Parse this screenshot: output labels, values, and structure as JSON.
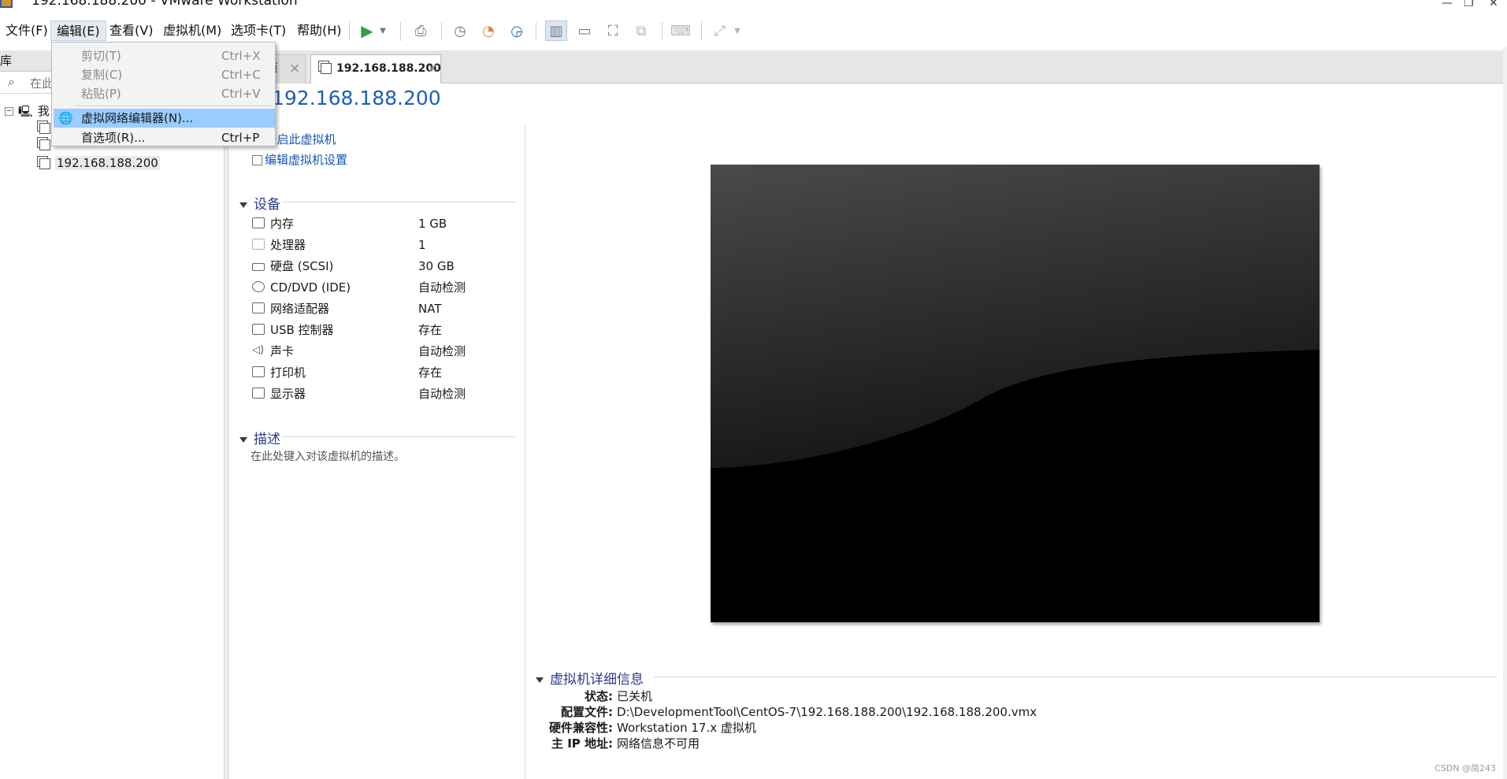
{
  "window": {
    "title": "192.168.188.200 - VMware Workstation"
  },
  "menubar": {
    "items": [
      "文件(F)",
      "编辑(E)",
      "查看(V)",
      "虚拟机(M)",
      "选项卡(T)",
      "帮助(H)"
    ]
  },
  "edit_menu": {
    "items": [
      {
        "label": "剪切(T)",
        "shortcut": "Ctrl+X"
      },
      {
        "label": "复制(C)",
        "shortcut": "Ctrl+C"
      },
      {
        "label": "粘贴(P)",
        "shortcut": "Ctrl+V"
      },
      {
        "label": "虚拟网络编辑器(N)...",
        "shortcut": ""
      },
      {
        "label": "首选项(R)...",
        "shortcut": "Ctrl+P"
      }
    ]
  },
  "library": {
    "header": "库",
    "search_placeholder": "在此",
    "root_label": "我",
    "vm_label": "192.168.188.200"
  },
  "tabs": {
    "inactive_label": "页",
    "active_label": "192.168.188.200",
    "close": "×"
  },
  "vm": {
    "title": "192.168.188.200",
    "power_on": "开启此虚拟机",
    "edit_settings": "编辑虚拟机设置"
  },
  "devices": {
    "heading": "设备",
    "rows": [
      {
        "name": "内存",
        "value": "1 GB",
        "icon": "memory-icon"
      },
      {
        "name": "处理器",
        "value": "1",
        "icon": "cpu-icon"
      },
      {
        "name": "硬盘 (SCSI)",
        "value": "30 GB",
        "icon": "harddisk-icon"
      },
      {
        "name": "CD/DVD (IDE)",
        "value": "自动检测",
        "icon": "cdrom-icon"
      },
      {
        "name": "网络适配器",
        "value": "NAT",
        "icon": "network-icon"
      },
      {
        "name": "USB 控制器",
        "value": "存在",
        "icon": "usb-icon"
      },
      {
        "name": "声卡",
        "value": "自动检测",
        "icon": "sound-icon"
      },
      {
        "name": "打印机",
        "value": "存在",
        "icon": "printer-icon"
      },
      {
        "name": "显示器",
        "value": "自动检测",
        "icon": "display-icon"
      }
    ]
  },
  "description": {
    "heading": "描述",
    "placeholder": "在此处键入对该虚拟机的描述。"
  },
  "details": {
    "heading": "虚拟机详细信息",
    "rows": [
      {
        "key": "状态:",
        "value": "已关机"
      },
      {
        "key": "配置文件:",
        "value": "D:\\DevelopmentTool\\CentOS-7\\192.168.188.200\\192.168.188.200.vmx"
      },
      {
        "key": "硬件兼容性:",
        "value": "Workstation 17.x 虚拟机"
      },
      {
        "key": "主 IP 地址:",
        "value": "网络信息不可用"
      }
    ]
  },
  "watermark": "CSDN @简243",
  "colors": {
    "accent": "#1f5fb5",
    "section": "#2d3a8c",
    "menu_highlight": "#99ccff",
    "play": "#2ea043"
  }
}
